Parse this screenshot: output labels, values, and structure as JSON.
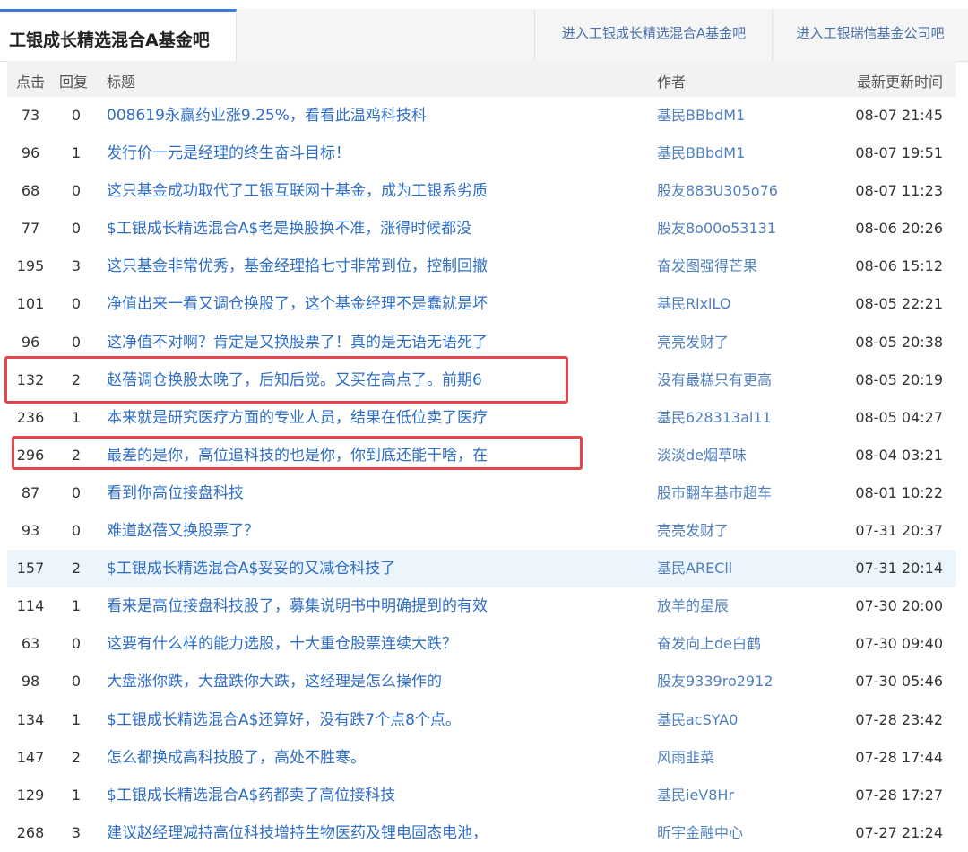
{
  "tabs": {
    "active_label": "工银成长精选混合A基金吧",
    "link1_label": "进入工银成长精选混合A基金吧",
    "link2_label": "进入工银瑞信基金公司吧"
  },
  "header": {
    "clicks": "点击",
    "replies": "回复",
    "title": "标题",
    "author": "作者",
    "updated": "最新更新时间"
  },
  "rows": [
    {
      "clicks": "73",
      "replies": "0",
      "title": "008619永赢药业涨9.25%，看看此温鸡科技科",
      "author": "基民BBbdM1",
      "time": "08-07 21:45"
    },
    {
      "clicks": "96",
      "replies": "1",
      "title": "发行价一元是经理的终生奋斗目标！",
      "author": "基民BBbdM1",
      "time": "08-07 19:51"
    },
    {
      "clicks": "68",
      "replies": "0",
      "title": "这只基金成功取代了工银互联网十基金，成为工银系劣质",
      "author": "股友883U305o76",
      "time": "08-07 11:23"
    },
    {
      "clicks": "77",
      "replies": "0",
      "title": "$工银成长精选混合A$老是换股换不准，涨得时候都没",
      "author": "股友8o00o53131",
      "time": "08-06 20:26"
    },
    {
      "clicks": "195",
      "replies": "3",
      "title": "这只基金非常优秀，基金经理掐七寸非常到位，控制回撤",
      "author": "奋发图强得芒果",
      "time": "08-06 15:12"
    },
    {
      "clicks": "101",
      "replies": "0",
      "title": "净值出来一看又调仓换股了，这个基金经理不是蠢就是坏",
      "author": "基民RlxlLO",
      "time": "08-05 22:21"
    },
    {
      "clicks": "96",
      "replies": "0",
      "title": "这净值不对啊？肯定是又换股票了！真的是无语无语死了",
      "author": "亮亮发财了",
      "time": "08-05 20:38"
    },
    {
      "clicks": "132",
      "replies": "2",
      "title": "赵蓓调仓换股太晚了，后知后觉。又买在高点了。前期6",
      "author": "没有最糕只有更高",
      "time": "08-05 20:19"
    },
    {
      "clicks": "236",
      "replies": "1",
      "title": "本来就是研究医疗方面的专业人员，结果在低位卖了医疗",
      "author": "基民628313al11",
      "time": "08-05 04:27"
    },
    {
      "clicks": "296",
      "replies": "2",
      "title": "最差的是你，高位追科技的也是你，你到底还能干啥，在",
      "author": "淡淡de烟草味",
      "time": "08-04 03:21"
    },
    {
      "clicks": "87",
      "replies": "0",
      "title": "看到你高位接盘科技",
      "author": "股市翻车基市超车",
      "time": "08-01 10:22"
    },
    {
      "clicks": "93",
      "replies": "0",
      "title": "难道赵蓓又换股票了？",
      "author": "亮亮发财了",
      "time": "07-31 20:37"
    },
    {
      "clicks": "157",
      "replies": "2",
      "title": "$工银成长精选混合A$妥妥的又减仓科技了",
      "author": "基民ARECll",
      "time": "07-31 20:14"
    },
    {
      "clicks": "114",
      "replies": "1",
      "title": "看来是高位接盘科技股了，募集说明书中明确提到的有效",
      "author": "放羊的星辰",
      "time": "07-30 20:00"
    },
    {
      "clicks": "63",
      "replies": "0",
      "title": "这要有什么样的能力选股，十大重仓股票连续大跌？",
      "author": "奋发向上de白鹤",
      "time": "07-30 09:40"
    },
    {
      "clicks": "98",
      "replies": "0",
      "title": "大盘涨你跌，大盘跌你大跌，这经理是怎么操作的",
      "author": "股友9339ro2912",
      "time": "07-30 05:46"
    },
    {
      "clicks": "134",
      "replies": "1",
      "title": "$工银成长精选混合A$还算好，没有跌7个点8个点。",
      "author": "基民acSYA0",
      "time": "07-28 23:42"
    },
    {
      "clicks": "147",
      "replies": "2",
      "title": "怎么都换成高科技股了，高处不胜寒。",
      "author": "风雨韭菜",
      "time": "07-28 17:44"
    },
    {
      "clicks": "129",
      "replies": "1",
      "title": "$工银成长精选混合A$药都卖了高位接科技",
      "author": "基民ieV8Hr",
      "time": "07-28 17:27"
    },
    {
      "clicks": "268",
      "replies": "3",
      "title": "建议赵经理减持高位科技增持生物医药及锂电固态电池，",
      "author": "昕宇金融中心",
      "time": "07-27 21:24"
    }
  ],
  "colors": {
    "accent": "#3a7dd8",
    "link": "#2f6ec5",
    "highlight_box": "#e8434c",
    "hover_row": "#edf5fc"
  }
}
